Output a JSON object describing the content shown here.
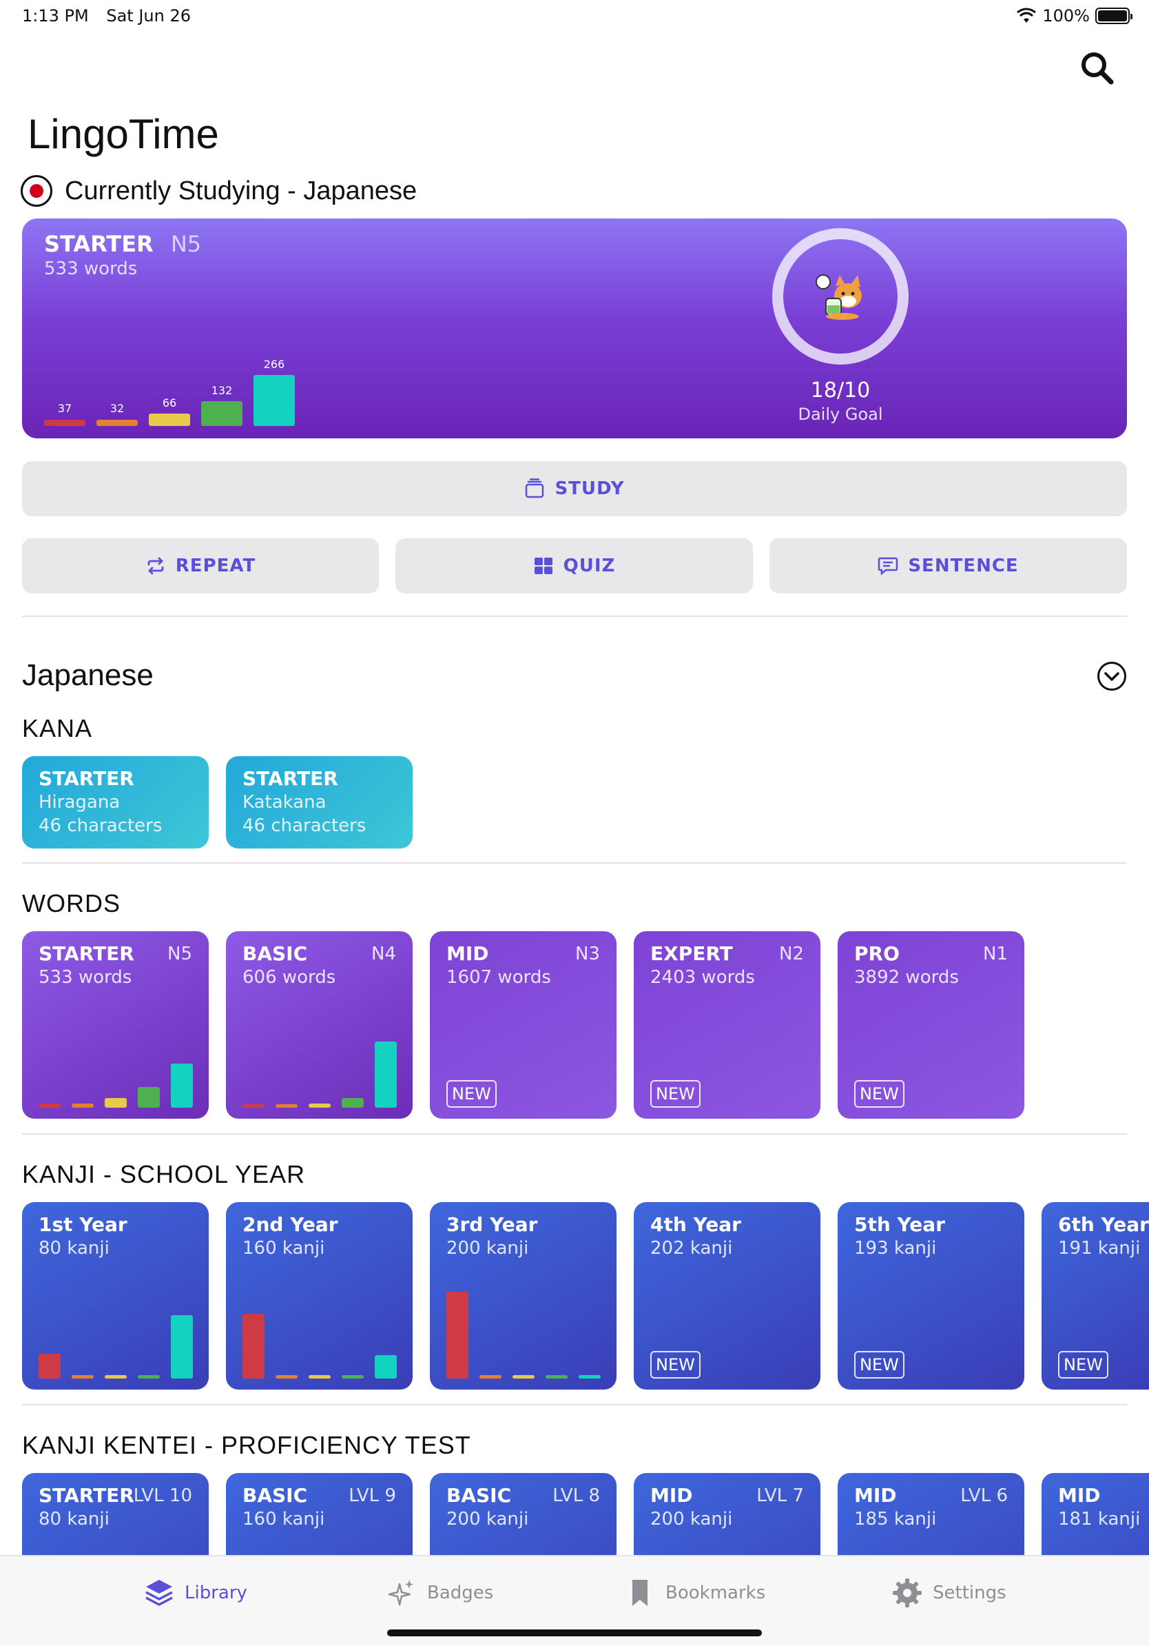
{
  "status": {
    "time": "1:13 PM",
    "date": "Sat Jun 26",
    "battery": "100%"
  },
  "header": {
    "title": "LingoTime",
    "studying": "Currently Studying - Japanese"
  },
  "hero": {
    "level": "STARTER",
    "level_code": "N5",
    "count": "533 words",
    "bar_values": [
      "37",
      "32",
      "66",
      "132",
      "266"
    ],
    "goal_value": "18/10",
    "goal_label": "Daily Goal"
  },
  "actions": {
    "study": "STUDY",
    "repeat": "REPEAT",
    "quiz": "QUIZ",
    "sentence": "SENTENCE"
  },
  "library": {
    "language": "Japanese",
    "kana_title": "KANA",
    "kana": [
      {
        "title": "STARTER",
        "name": "Hiragana",
        "count": "46 characters"
      },
      {
        "title": "STARTER",
        "name": "Katakana",
        "count": "46 characters"
      }
    ],
    "words_title": "WORDS",
    "words": [
      {
        "title": "STARTER",
        "badge": "N5",
        "count": "533 words"
      },
      {
        "title": "BASIC",
        "badge": "N4",
        "count": "606 words"
      },
      {
        "title": "MID",
        "badge": "N3",
        "count": "1607 words",
        "tag": "NEW"
      },
      {
        "title": "EXPERT",
        "badge": "N2",
        "count": "2403 words",
        "tag": "NEW"
      },
      {
        "title": "PRO",
        "badge": "N1",
        "count": "3892 words",
        "tag": "NEW"
      }
    ],
    "kanji_title": "KANJI - SCHOOL YEAR",
    "kanji": [
      {
        "title": "1st Year",
        "count": "80 kanji"
      },
      {
        "title": "2nd Year",
        "count": "160 kanji"
      },
      {
        "title": "3rd Year",
        "count": "200 kanji"
      },
      {
        "title": "4th Year",
        "count": "202 kanji",
        "tag": "NEW"
      },
      {
        "title": "5th Year",
        "count": "193 kanji",
        "tag": "NEW"
      },
      {
        "title": "6th Year",
        "count": "191 kanji",
        "tag": "NEW"
      }
    ],
    "kentei_title": "KANJI KENTEI - PROFICIENCY TEST",
    "kentei": [
      {
        "title": "STARTER",
        "badge": "LVL 10",
        "count": "80 kanji"
      },
      {
        "title": "BASIC",
        "badge": "LVL 9",
        "count": "160 kanji"
      },
      {
        "title": "BASIC",
        "badge": "LVL 8",
        "count": "200 kanji"
      },
      {
        "title": "MID",
        "badge": "LVL 7",
        "count": "200 kanji"
      },
      {
        "title": "MID",
        "badge": "LVL 6",
        "count": "185 kanji"
      },
      {
        "title": "MID",
        "count": "181 kanji"
      }
    ]
  },
  "tabs": {
    "library": "Library",
    "badges": "Badges",
    "bookmarks": "Bookmarks",
    "settings": "Settings"
  },
  "colors": {
    "accent": "#5b4fd9",
    "bar_red": "#cf3b45",
    "bar_orange": "#e4812f",
    "bar_yellow": "#e9c94a",
    "bar_green": "#4fb04f",
    "bar_teal": "#13d3c0"
  }
}
